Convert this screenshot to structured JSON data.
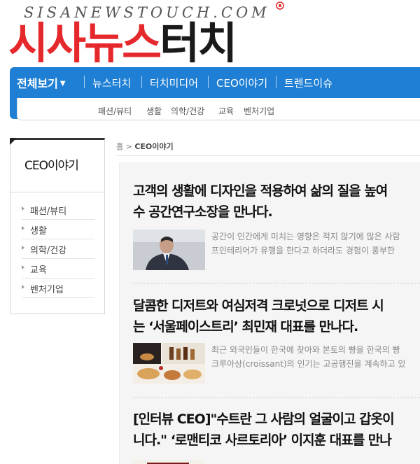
{
  "header": {
    "site_url": "SISANEWSTOUCH.COM",
    "site_name_red": "시사뉴스",
    "site_name_black": "터치",
    "accent_red": "#e5282c",
    "nav_blue": "#1f7fd4"
  },
  "gnb": {
    "all_label": "전체보기",
    "items": [
      "뉴스터치",
      "터치미디어",
      "CEO이야기",
      "트렌드이슈"
    ]
  },
  "subnav": {
    "items": [
      "패션/뷰티",
      "생활",
      "의학/건강",
      "교육",
      "벤처기업"
    ]
  },
  "sidebar": {
    "title": "CEO이야기",
    "items": [
      "패션/뷰티",
      "생활",
      "의학/건강",
      "교육",
      "벤처기업"
    ]
  },
  "breadcrumb": {
    "home": "홈",
    "separator": ">",
    "current": "CEO이야기"
  },
  "articles": [
    {
      "title_line1": "고객의 생활에 디자인을 적용하여 삶의 질을 높여",
      "title_line2": "수 공간연구소장을 만나다.",
      "summary_line1": "공간이 인간에게 미치는 영향은 적지 않기에 많은 사람",
      "summary_line2": "프인테리어가 유행을 한다고 하더라도 경험이 풍부한"
    },
    {
      "title_line1": "달콤한 디저트와 여심저격 크로넛으로 디저트 시",
      "title_line2": "는 ‘서울페이스트리’ 최민재 대표를 만나다.",
      "summary_line1": "최근 외국인들이 한국에 찾아와 본토의 빵을 한국의 빵",
      "summary_line2": "크루아상(croissant)의 인기는 고공행진을 계속하고 있"
    },
    {
      "title_line1": "[인터뷰 CEO]\"수트란 그 사람의 얼굴이고 갑옷이",
      "title_line2": "니다.\" ‘로맨티코 사르토리아’ 이지훈 대표를 만나",
      "summary_line1": "",
      "summary_line2": ""
    }
  ]
}
